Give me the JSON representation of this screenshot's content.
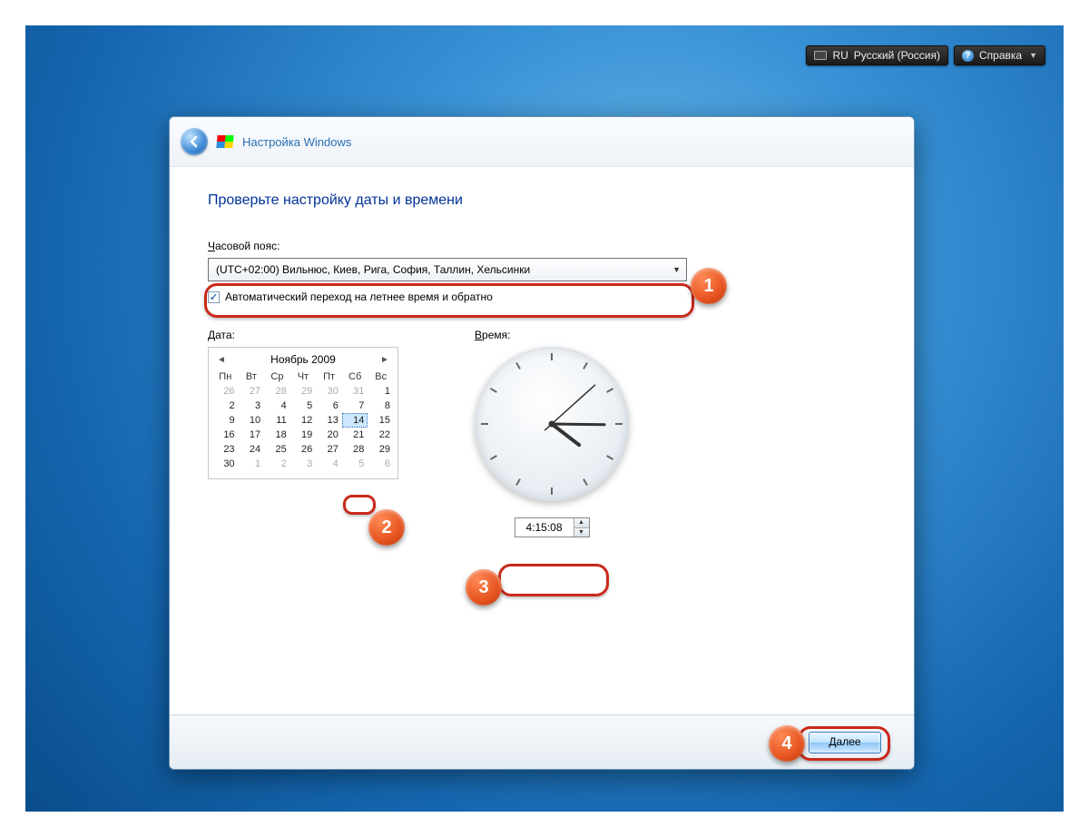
{
  "topbar": {
    "lang_code": "RU",
    "lang_label": "Русский (Россия)",
    "help_label": "Справка"
  },
  "window": {
    "title": "Настройка Windows"
  },
  "page": {
    "heading": "Проверьте настройку даты и времени",
    "timezone_label_html": "Часовой пояс:",
    "timezone_label_u": "Ч",
    "timezone_label_rest": "асовой пояс:",
    "timezone_value": "(UTC+02:00) Вильнюс, Киев, Рига, София, Таллин, Хельсинки",
    "dst_label": "Автоматический переход на летнее время и обратно",
    "dst_checked": "✓",
    "date_label_u": "Д",
    "date_label_rest": "ата:",
    "time_label_u": "В",
    "time_label_rest": "ремя:"
  },
  "calendar": {
    "month_label": "Ноябрь 2009",
    "weekdays": [
      "Пн",
      "Вт",
      "Ср",
      "Чт",
      "Пт",
      "Сб",
      "Вс"
    ],
    "cells": [
      {
        "v": "26",
        "g": true
      },
      {
        "v": "27",
        "g": true
      },
      {
        "v": "28",
        "g": true
      },
      {
        "v": "29",
        "g": true
      },
      {
        "v": "30",
        "g": true
      },
      {
        "v": "31",
        "g": true
      },
      {
        "v": "1"
      },
      {
        "v": "2"
      },
      {
        "v": "3"
      },
      {
        "v": "4"
      },
      {
        "v": "5"
      },
      {
        "v": "6"
      },
      {
        "v": "7"
      },
      {
        "v": "8"
      },
      {
        "v": "9"
      },
      {
        "v": "10"
      },
      {
        "v": "11"
      },
      {
        "v": "12"
      },
      {
        "v": "13"
      },
      {
        "v": "14",
        "sel": true
      },
      {
        "v": "15"
      },
      {
        "v": "16"
      },
      {
        "v": "17"
      },
      {
        "v": "18"
      },
      {
        "v": "19"
      },
      {
        "v": "20"
      },
      {
        "v": "21"
      },
      {
        "v": "22"
      },
      {
        "v": "23"
      },
      {
        "v": "24"
      },
      {
        "v": "25"
      },
      {
        "v": "26"
      },
      {
        "v": "27"
      },
      {
        "v": "28"
      },
      {
        "v": "29"
      },
      {
        "v": "30"
      },
      {
        "v": "1",
        "g": true
      },
      {
        "v": "2",
        "g": true
      },
      {
        "v": "3",
        "g": true
      },
      {
        "v": "4",
        "g": true
      },
      {
        "v": "5",
        "g": true
      },
      {
        "v": "6",
        "g": true
      }
    ]
  },
  "time": {
    "value": "4:15:08"
  },
  "footer": {
    "next_label": "Далее"
  },
  "annotations": {
    "b1": "1",
    "b2": "2",
    "b3": "3",
    "b4": "4"
  }
}
